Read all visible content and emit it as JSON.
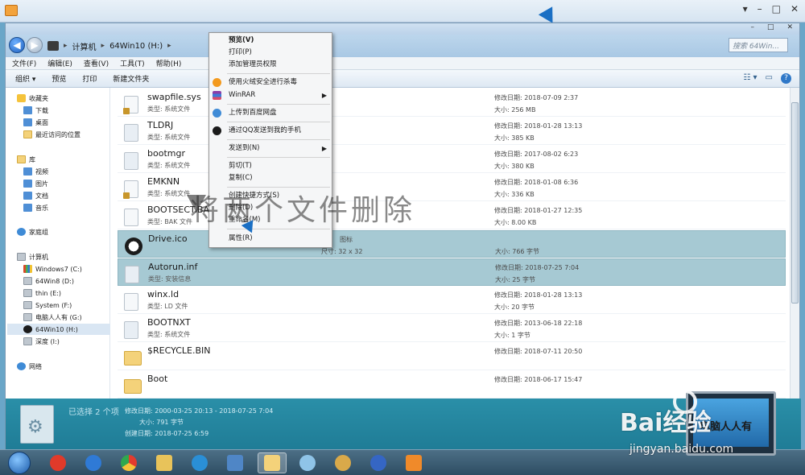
{
  "window": {
    "outer_controls": [
      "▾",
      "–",
      "□",
      "✕"
    ]
  },
  "explorer": {
    "title_controls": [
      "–",
      "□",
      "✕"
    ],
    "breadcrumb": [
      "计算机",
      "64Win10 (H:)"
    ],
    "search_placeholder": "搜索 64Win...",
    "menu": [
      "文件(F)",
      "编辑(E)",
      "查看(V)",
      "工具(T)",
      "帮助(H)"
    ],
    "toolbar": [
      "组织 ▾",
      "预览",
      "打印",
      "新建文件夹"
    ]
  },
  "nav": {
    "favorites": "收藏夹",
    "downloads": "下载",
    "desktop": "桌面",
    "recent": "最近访问的位置",
    "libraries": "库",
    "videos": "视频",
    "pictures": "图片",
    "documents": "文档",
    "music": "音乐",
    "homegroup": "家庭组",
    "computer": "计算机",
    "drives": [
      "Windows7 (C:)",
      "64Win8 (D:)",
      "thin (E:)",
      "System (F:)",
      "电脑人人有 (G:)",
      "64Win10 (H:)",
      "深度 (I:)"
    ],
    "network": "网络"
  },
  "files": [
    {
      "name": "swapfile.sys",
      "type": "类型: 系统文件",
      "date": "修改日期: 2018-07-09 2:37",
      "size": "大小: 256 MB",
      "icon": "lock"
    },
    {
      "name": "TLDRJ",
      "type": "类型: 系统文件",
      "date": "修改日期: 2018-01-28 13:13",
      "size": "大小: 385 KB",
      "icon": "cfg"
    },
    {
      "name": "bootmgr",
      "type": "类型: 系统文件",
      "date": "修改日期: 2017-08-02 6:23",
      "size": "大小: 380 KB",
      "icon": "cfg"
    },
    {
      "name": "EMKNN",
      "type": "类型: 系统文件",
      "date": "修改日期: 2018-01-08 6:36",
      "size": "大小: 336 KB",
      "icon": "lock"
    },
    {
      "name": "BOOTSECT.BAK",
      "type": "类型: BAK 文件",
      "date": "修改日期: 2018-01-27 12:35",
      "size": "大小: 8.00 KB",
      "icon": "plain"
    },
    {
      "name": "Drive.ico",
      "type": "",
      "mid1": "图标",
      "mid2": "尺寸: 32 x 32",
      "date": "",
      "size": "大小: 766 字节",
      "icon": "panda",
      "selected": true
    },
    {
      "name": "Autorun.inf",
      "type": "类型: 安装信息",
      "date": "修改日期: 2018-07-25 7:04",
      "size": "大小: 25 字节",
      "icon": "cfg",
      "selected": true
    },
    {
      "name": "winx.ld",
      "type": "类型: LD 文件",
      "date": "修改日期: 2018-01-28 13:13",
      "size": "大小: 20 字节",
      "icon": "plain"
    },
    {
      "name": "BOOTNXT",
      "type": "类型: 系统文件",
      "date": "修改日期: 2013-06-18 22:18",
      "size": "大小: 1 字节",
      "icon": "cfg"
    },
    {
      "name": "$RECYCLE.BIN",
      "type": "",
      "date": "修改日期: 2018-07-11 20:50",
      "size": "",
      "icon": "folder"
    },
    {
      "name": "Boot",
      "type": "",
      "date": "修改日期: 2018-06-17 15:47",
      "size": "",
      "icon": "folder"
    }
  ],
  "details": {
    "selected": "已选择 2 个项",
    "date_range": "修改日期: 2000-03-25 20:13 - 2018-07-25 7:04",
    "size": "大小: 791 字节",
    "created": "创建日期: 2018-07-25 6:59"
  },
  "context_menu": [
    {
      "label": "预览(V)",
      "bold": true
    },
    {
      "label": "打印(P)"
    },
    {
      "label": "添加管理员权限"
    },
    {
      "sep": true
    },
    {
      "label": "使用火绒安全进行杀毒",
      "icon": "fire-icon"
    },
    {
      "label": "WinRAR",
      "icon": "winrar-icon",
      "submenu": true
    },
    {
      "sep": true
    },
    {
      "label": "上传到百度网盘",
      "icon": "baidu-cloud-icon"
    },
    {
      "sep": true
    },
    {
      "label": "通过QQ发送到我的手机",
      "icon": "qq-icon"
    },
    {
      "sep": true
    },
    {
      "label": "发送到(N)",
      "submenu": true
    },
    {
      "sep": true
    },
    {
      "label": "剪切(T)"
    },
    {
      "label": "复制(C)"
    },
    {
      "sep": true
    },
    {
      "label": "创建快捷方式(S)"
    },
    {
      "label": "删除(D)"
    },
    {
      "label": "重命名(M)"
    },
    {
      "sep": true
    },
    {
      "label": "属性(R)"
    }
  ],
  "overlay_caption": "将两个文件删除",
  "watermark": {
    "brand": "Bai经验",
    "url": "jingyan.baidu.com",
    "laptop_caption": "电脑人人有"
  },
  "taskbar": [
    "start",
    "tile-app",
    "ie",
    "chrome",
    "folder-app",
    "qq-browser",
    "remote",
    "explorer",
    "settings",
    "paint",
    "wmp",
    "media"
  ]
}
